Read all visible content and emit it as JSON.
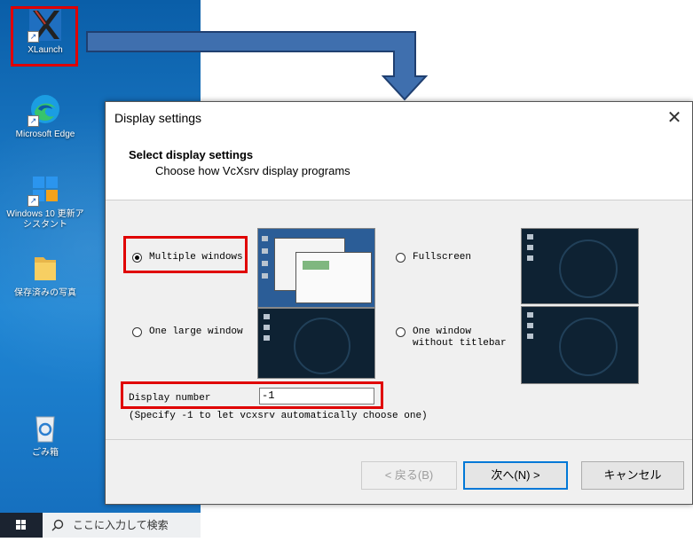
{
  "desktop": {
    "icons": [
      {
        "label": "XLaunch"
      },
      {
        "label": "Microsoft Edge"
      },
      {
        "label": "Windows 10 更新アシスタント"
      },
      {
        "label": "保存済みの写真"
      },
      {
        "label": "ごみ箱"
      }
    ]
  },
  "taskbar": {
    "search_placeholder": "ここに入力して検索"
  },
  "dialog": {
    "title": "Display settings",
    "close_glyph": "✕",
    "heading": "Select display settings",
    "subheading": "Choose how VcXsrv display programs",
    "options": [
      {
        "label": "Multiple windows",
        "selected": true
      },
      {
        "label": "Fullscreen",
        "selected": false
      },
      {
        "label": "One large window",
        "selected": false
      },
      {
        "label_line1": "One window",
        "label_line2": "without titlebar",
        "selected": false
      }
    ],
    "display_number_label": "Display number",
    "display_number_value": "-1",
    "hint": "(Specify -1 to let vcxsrv automatically choose one)",
    "buttons": {
      "back": "< 戻る(B)",
      "next": "次へ(N) >",
      "cancel": "キャンセル"
    }
  },
  "colors": {
    "highlight": "#e00000",
    "arrow": "#3f6fae",
    "desktop": "#1a78c4"
  },
  "icon_names": [
    "xlaunch-icon",
    "edge-icon",
    "windows-update-icon",
    "folder-icon",
    "recycle-bin-icon",
    "windows-start-icon",
    "search-icon",
    "close-icon"
  ]
}
